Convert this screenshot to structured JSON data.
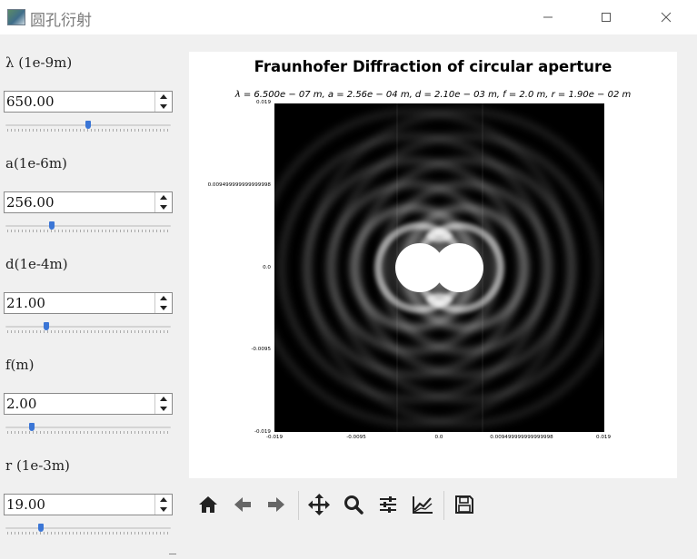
{
  "window": {
    "title": "圆孔衍射",
    "controls": [
      "minimize-icon",
      "maximize-icon",
      "close-icon"
    ]
  },
  "params": [
    {
      "label": "λ (1e-9m)",
      "value": "650.00",
      "slider_fraction": 0.5
    },
    {
      "label": "a(1e-6m)",
      "value": "256.00",
      "slider_fraction": 0.27
    },
    {
      "label": "d(1e-4m)",
      "value": "21.00",
      "slider_fraction": 0.23
    },
    {
      "label": "f(m)",
      "value": "2.00",
      "slider_fraction": 0.14
    },
    {
      "label": "r (1e-3m)",
      "value": "19.00",
      "slider_fraction": 0.2
    }
  ],
  "figure": {
    "title": "Fraunhofer Diffraction of circular aperture",
    "subtitle": "λ = 6.500e − 07 m,  a = 2.56e − 04 m,  d = 2.10e − 03 m,  f = 2.0 m,  r = 1.90e − 02 m"
  },
  "chart_data": {
    "type": "heatmap",
    "title": "Fraunhofer Diffraction of circular aperture",
    "subtitle": "λ = 6.500e − 07 m,  a = 2.56e − 04 m,  d = 2.10e − 03 m,  f = 2.0 m,  r = 1.90e − 02 m",
    "colormap": "gray",
    "x_ticks": [
      "-0.019",
      "-0.0095",
      "0.0",
      "0.009499999999999998",
      "0.019"
    ],
    "y_ticks": [
      "0.019",
      "0.009499999999999998",
      "0.0",
      "-0.0095",
      "-0.019"
    ],
    "xlim": [
      -0.019,
      0.019
    ],
    "ylim": [
      -0.019,
      0.019
    ],
    "parameters": {
      "lambda_m": 6.5e-07,
      "a_m": 0.000256,
      "d_m": 0.0021,
      "f_m": 2.0,
      "r_m": 0.019
    }
  },
  "toolbar": {
    "buttons": [
      "home-icon",
      "back-icon",
      "forward-icon",
      "pan-icon",
      "zoom-icon",
      "configure-subplots-icon",
      "edit-axes-icon",
      "save-icon"
    ]
  }
}
